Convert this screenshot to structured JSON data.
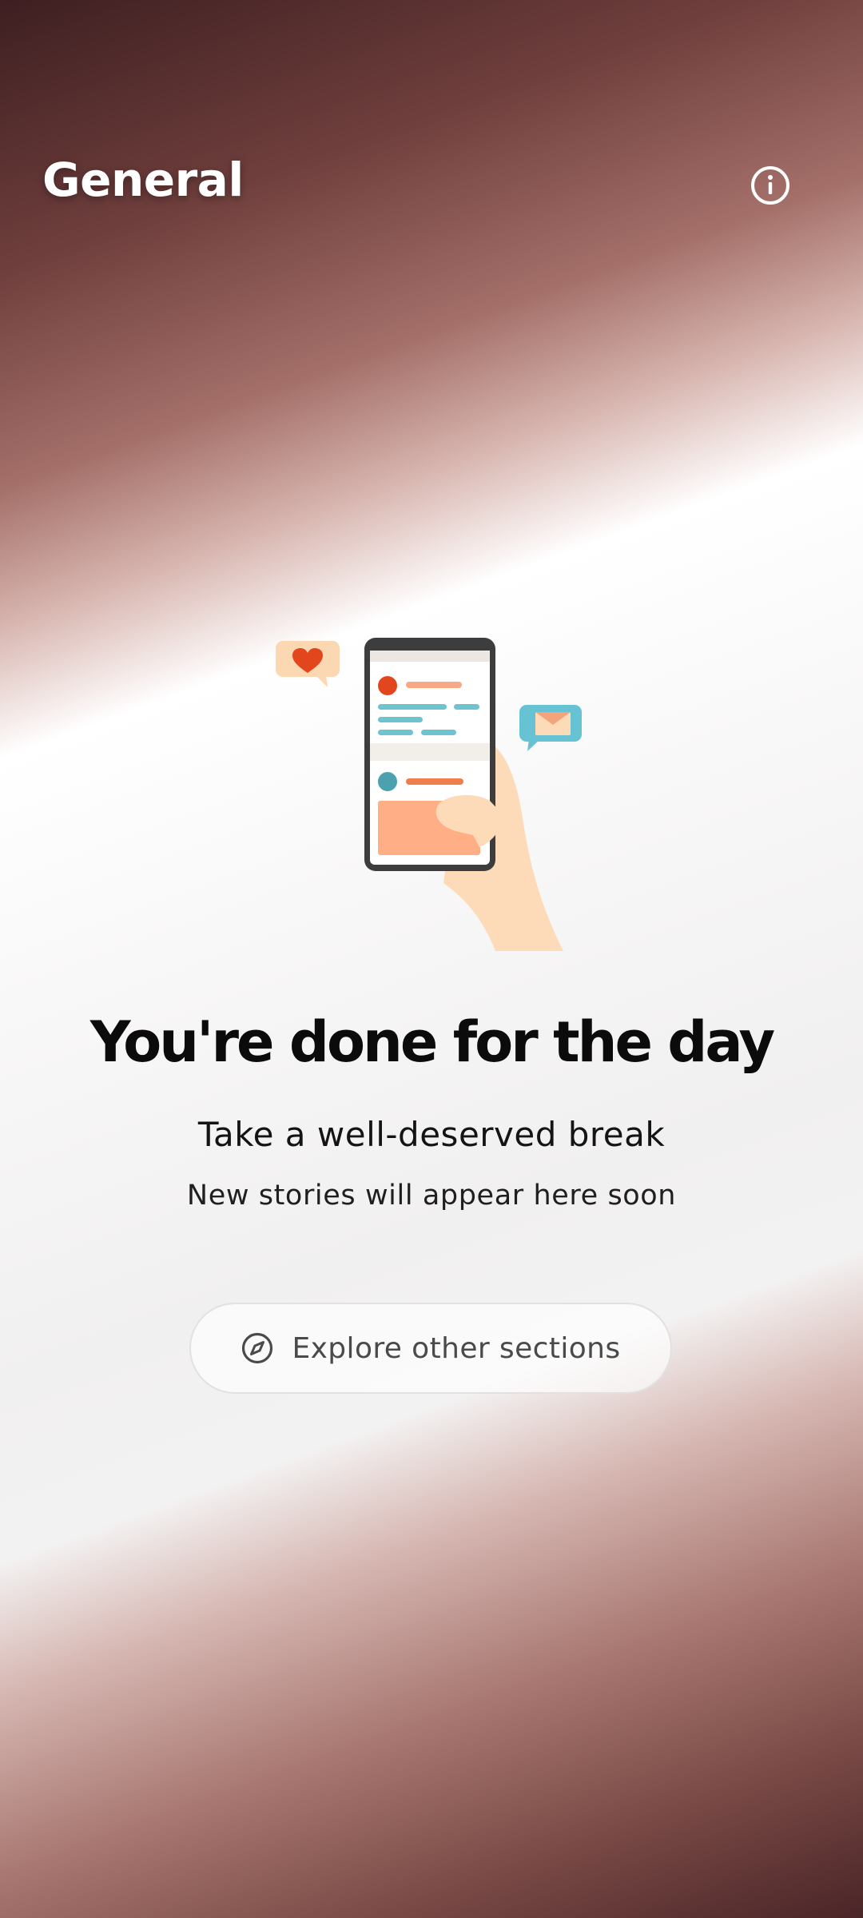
{
  "header": {
    "title": "General",
    "info_icon": "info-circle-icon"
  },
  "illustration": {
    "icons": [
      "heart-icon",
      "mail-icon",
      "phone-in-hand"
    ],
    "colors": {
      "heart": "#e1461d",
      "heart_bubble": "#fbd7b2",
      "mail_bubble": "#67c2d4",
      "line_orange": "#f48b5a",
      "line_teal": "#6ec3d3",
      "skin": "#fddbb9"
    }
  },
  "empty_state": {
    "headline": "You're done for the day",
    "subtitle": "Take a well-deserved break",
    "subtext": "New stories will appear here soon"
  },
  "explore_button": {
    "label": "Explore other sections",
    "icon": "compass-icon"
  }
}
